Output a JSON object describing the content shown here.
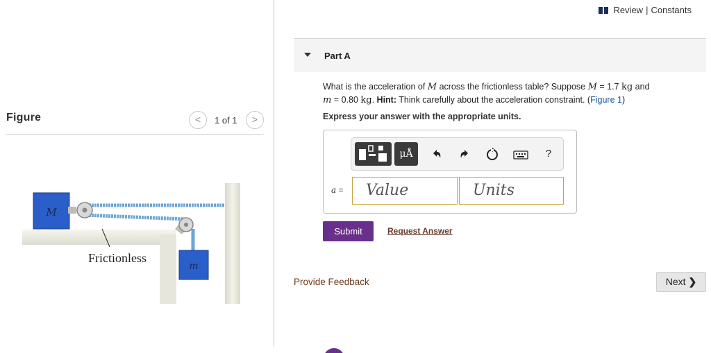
{
  "left_pane": {
    "figure_label": "Figure",
    "pager_prev": "<",
    "pager_text": "1 of 1",
    "pager_next": ">",
    "figure": {
      "block_M_label": "M",
      "block_m_label": "m",
      "surface_label": "Frictionless"
    }
  },
  "header": {
    "review_label": "Review",
    "separator": "|",
    "constants_label": "Constants"
  },
  "part": {
    "title": "Part A"
  },
  "question": {
    "p1": "What is the acceleration of ",
    "var_M": "M",
    "p2": " across the frictionless table? Suppose ",
    "var_M2": "M",
    "p3": " = 1.7 ",
    "unit1": "kg",
    "p4": " and",
    "var_m": "m",
    "p5": " = 0.80 ",
    "unit2": "kg",
    "p6": ". ",
    "hint_label": "Hint:",
    "p7": " Think carefully about the acceleration constraint. (",
    "figure_link": "Figure 1",
    "p8": ")",
    "express": "Express your answer with the appropriate units."
  },
  "toolbar": {
    "units_button": "μÅ",
    "undo_icon": "undo-icon",
    "redo_icon": "redo-icon",
    "reset_icon": "reset-icon",
    "keyboard_icon": "keyboard-icon",
    "help_label": "?"
  },
  "answer": {
    "var_label": "a",
    "equals": "=",
    "value_placeholder": "Value",
    "units_placeholder": "Units"
  },
  "actions": {
    "submit_label": "Submit",
    "request_label": "Request Answer",
    "feedback_label": "Provide Feedback",
    "next_label": "Next"
  },
  "colors": {
    "submit_bg": "#6a2f8a",
    "block_blue": "#2a5ec9",
    "rope_blue": "#6aa6d8",
    "field_border": "#c9a33a",
    "link_brown": "#6a3a1a"
  }
}
